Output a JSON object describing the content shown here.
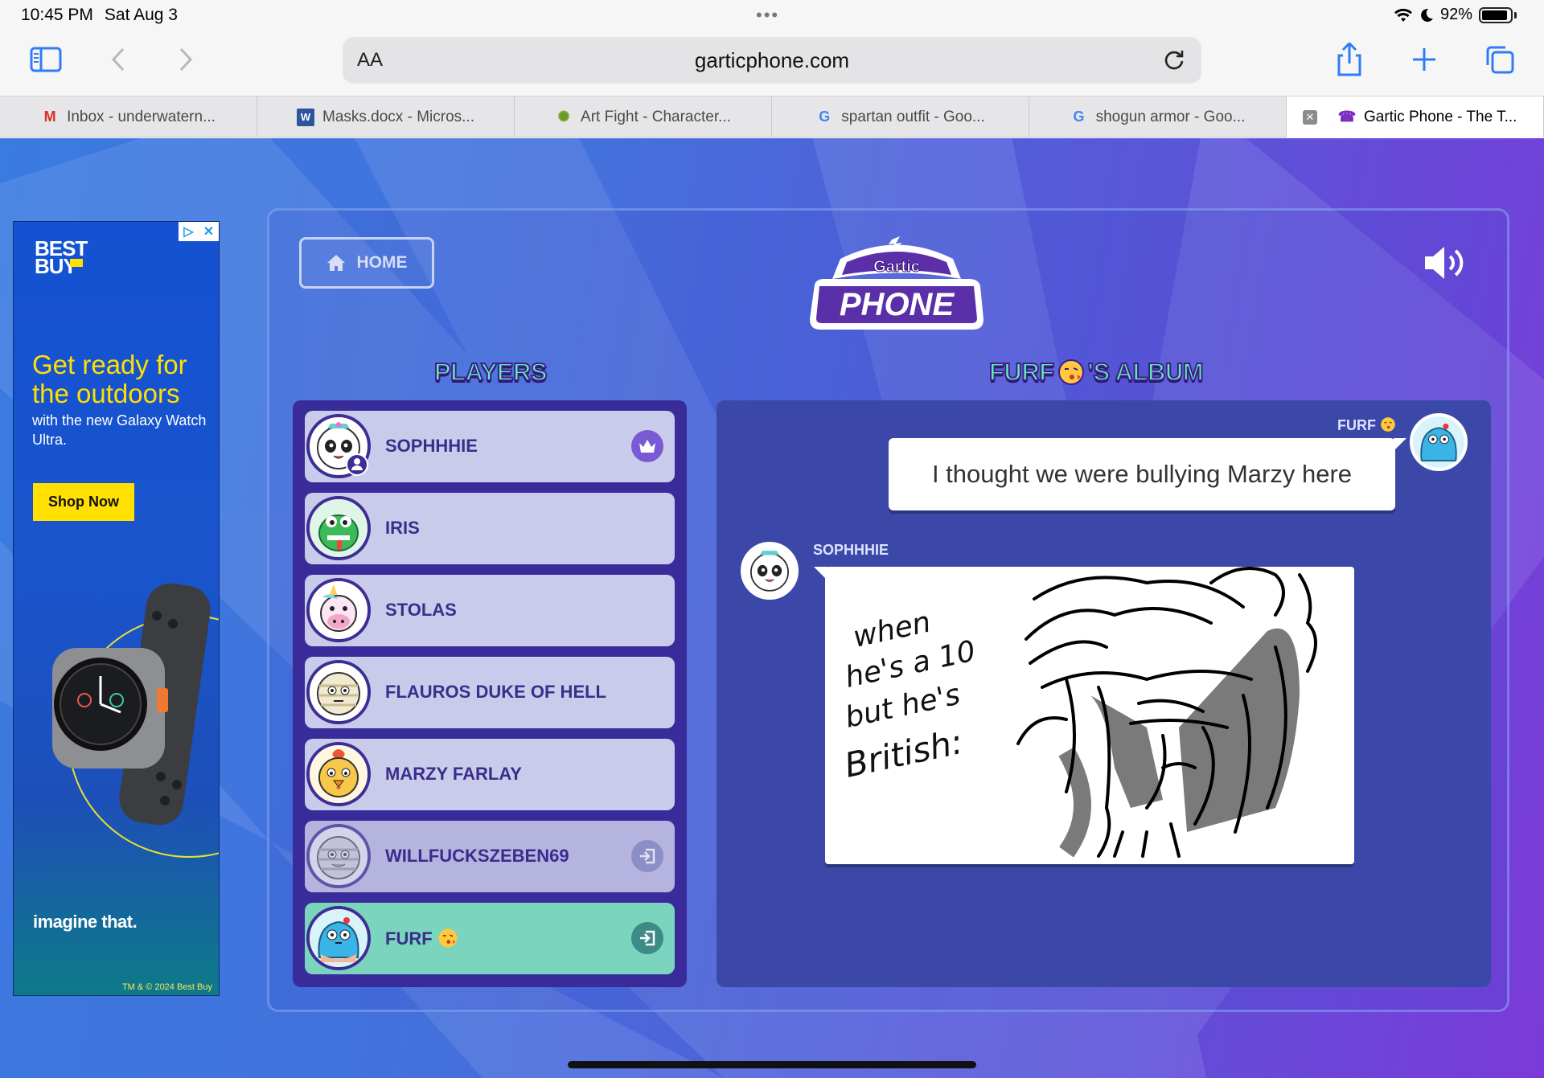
{
  "status_bar": {
    "time": "10:45 PM",
    "date": "Sat Aug 3",
    "battery": "92%"
  },
  "browser": {
    "address_prefix": "AA",
    "url": "garticphone.com",
    "tabs": [
      {
        "label": "Inbox - underwatern...",
        "icon": "gmail-icon"
      },
      {
        "label": "Masks.docx - Micros...",
        "icon": "word-icon"
      },
      {
        "label": "Art Fight - Character...",
        "icon": "artfight-icon"
      },
      {
        "label": "spartan outfit - Goo...",
        "icon": "google-icon"
      },
      {
        "label": "shogun armor - Goo...",
        "icon": "google-icon"
      },
      {
        "label": "Gartic Phone - The T...",
        "icon": "gartic-icon",
        "active": true
      }
    ]
  },
  "ad": {
    "brand": "BEST BUY",
    "headline": "Get ready for the outdoors",
    "subtext": "with the new Galaxy Watch Ultra.",
    "cta": "Shop Now",
    "tagline": "imagine that.",
    "fineprint": "TM & © 2024 Best Buy"
  },
  "game": {
    "home_label": "HOME",
    "logo_top": "Gartic",
    "logo_bottom": "PHONE",
    "players_title": "PLAYERS",
    "album_title_name": "FURF",
    "album_title_suffix": "'S ALBUM",
    "players": [
      {
        "name": "SOPHHHIE",
        "badge": "crown-icon"
      },
      {
        "name": "IRIS",
        "badge": ""
      },
      {
        "name": "STOLAS",
        "badge": ""
      },
      {
        "name": "FLAUROS DUKE OF HELL",
        "badge": ""
      },
      {
        "name": "MARZY FARLAY",
        "badge": ""
      },
      {
        "name": "WILLFUCKSZEBEN69",
        "badge": "exit-icon"
      },
      {
        "name": "FURF",
        "badge": "exit-icon",
        "highlight": true
      }
    ],
    "album": {
      "first_author": "FURF",
      "first_text": "I thought we were bullying Marzy here",
      "second_author": "SOPHHHIE",
      "drawing_caption": [
        "when",
        "he's a 10",
        "but he's",
        "British:"
      ]
    }
  }
}
